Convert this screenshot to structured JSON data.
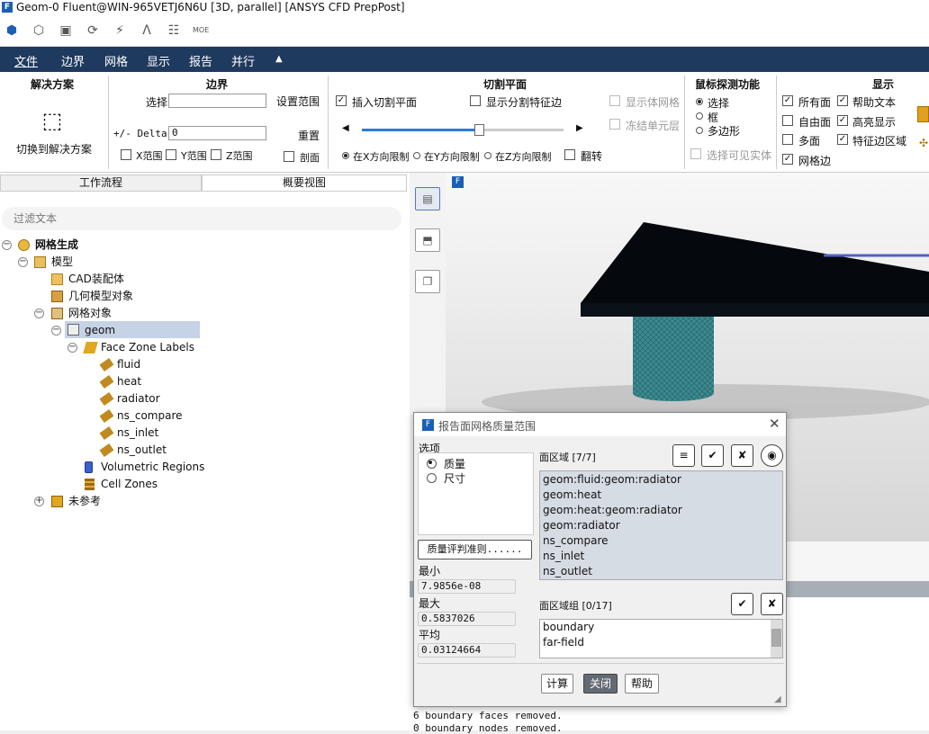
{
  "window": {
    "title": "Geom-0 Fluent@WIN-965VETJ6N6U  [3D, parallel] [ANSYS CFD PrepPost]"
  },
  "menu": {
    "items": [
      "文件",
      "边界",
      "网格",
      "显示",
      "报告",
      "并行"
    ]
  },
  "ribbon": {
    "solution": {
      "title": "解决方案",
      "button": "切换到解决方案"
    },
    "boundary": {
      "title": "边界",
      "select_label": "选择",
      "set_range": "设置范围",
      "delta_label": "+/- Delta",
      "delta_value": "0",
      "reset": "重置",
      "x_range": "X范围",
      "y_range": "Y范围",
      "z_range": "Z范围",
      "section": "剖面"
    },
    "cut_plane": {
      "title": "切割平面",
      "insert": "插入切割平面",
      "show_split": "显示分割特征边",
      "x_limit": "在X方向限制",
      "y_limit": "在Y方向限制",
      "z_limit": "在Z方向限制",
      "flip": "翻转",
      "slider_value": 0.58
    },
    "display_extra": {
      "show_volume_mesh": "显示体网格",
      "freeze_layer": "冻结单元层"
    },
    "probe": {
      "title": "鼠标探测功能",
      "select": "选择",
      "box": "框",
      "polygon": "多边形",
      "select_visible": "选择可见实体"
    },
    "display": {
      "title": "显示",
      "all_faces": "所有面",
      "free_faces": "自由面",
      "multi_faces": "多面",
      "mesh_edges": "网格边",
      "help_text": "帮助文本",
      "highlight": "高亮显示",
      "feature_edges": "特征边区域"
    }
  },
  "tabs": {
    "workflow": "工作流程",
    "outline": "概要视图"
  },
  "filter": {
    "placeholder": "过滤文本"
  },
  "tree": {
    "root": "网格生成",
    "model": "模型",
    "cad": "CAD装配体",
    "geom_objects": "几何模型对象",
    "mesh_objects": "网格对象",
    "geom": "geom",
    "face_zone_labels": "Face Zone Labels",
    "labels": [
      "fluid",
      "heat",
      "radiator",
      "ns_compare",
      "ns_inlet",
      "ns_outlet"
    ],
    "volumetric": "Volumetric Regions",
    "cell_zones": "Cell Zones",
    "unreferenced": "未参考"
  },
  "console": {
    "lines": [
      "6 boundary faces removed.",
      "0 boundary nodes removed."
    ]
  },
  "dialog": {
    "title": "报告面网格质量范围",
    "options_label": "选项",
    "opt_quality": "质量",
    "opt_size": "尺寸",
    "criteria_button": "质量评判准则......",
    "min_label": "最小",
    "min_value": "7.9856e-08",
    "max_label": "最大",
    "max_value": "0.5837026",
    "avg_label": "平均",
    "avg_value": "0.03124664",
    "zones_label": "面区域 [7/7]",
    "zones": [
      "geom:fluid:geom:radiator",
      "geom:heat",
      "geom:heat:geom:radiator",
      "geom:radiator",
      "ns_compare",
      "ns_inlet",
      "ns_outlet"
    ],
    "groups_label": "面区域组 [0/17]",
    "groups": [
      "boundary",
      "far-field"
    ],
    "compute": "计算",
    "close": "关闭",
    "help": "帮助"
  }
}
